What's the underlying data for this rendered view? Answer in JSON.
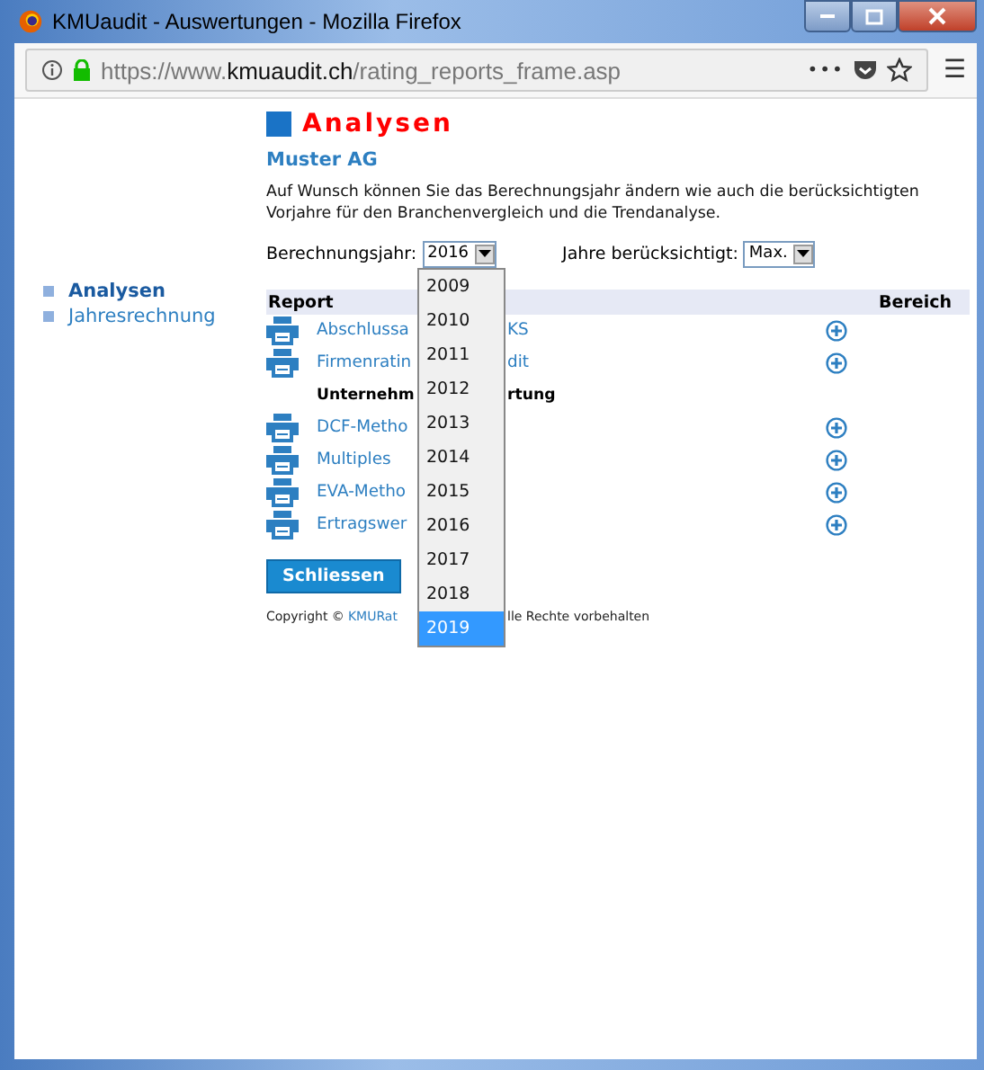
{
  "window": {
    "title": "KMUaudit - Auswertungen - Mozilla Firefox"
  },
  "address_bar": {
    "url_prefix": "https://www.",
    "url_domain": "kmuaudit.ch",
    "url_path": "/rating_reports_frame.asp",
    "menu_dots": "•••",
    "hamburger": "☰"
  },
  "sidebar": {
    "items": [
      {
        "label": "Analysen",
        "selected": true
      },
      {
        "label": "Jahresrechnung",
        "selected": false
      }
    ]
  },
  "page": {
    "heading": "Analysen",
    "company": "Muster AG",
    "description": "Auf Wunsch können Sie das Berechnungsjahr ändern wie auch die berücksichtigten Vorjahre für den Branchenvergleich und die Trendanalyse.",
    "year_select": {
      "label": "Berechnungsjahr:",
      "value": "2016"
    },
    "years_select": {
      "label": "Jahre berücksichtigt:",
      "value": "Max."
    },
    "year_options": [
      {
        "label": "2009",
        "selected": false
      },
      {
        "label": "2010",
        "selected": false
      },
      {
        "label": "2011",
        "selected": false
      },
      {
        "label": "2012",
        "selected": false
      },
      {
        "label": "2013",
        "selected": false
      },
      {
        "label": "2014",
        "selected": false
      },
      {
        "label": "2015",
        "selected": false
      },
      {
        "label": "2016",
        "selected": false
      },
      {
        "label": "2017",
        "selected": false
      },
      {
        "label": "2018",
        "selected": false
      },
      {
        "label": "2019",
        "selected": true
      }
    ],
    "table": {
      "columns": [
        "Report",
        "Bereich"
      ],
      "rows": [
        {
          "kind": "report",
          "label_start": "Abschlussa",
          "label_end": "KS"
        },
        {
          "kind": "report",
          "label_start": "Firmenratin",
          "label_end": "dit"
        },
        {
          "kind": "group",
          "label_start": "Unternehm",
          "label_end": "rtung"
        },
        {
          "kind": "report",
          "label_start": "DCF-Metho"
        },
        {
          "kind": "report",
          "label_start": "Multiples"
        },
        {
          "kind": "report",
          "label_start": "EVA-Metho"
        },
        {
          "kind": "report",
          "label_start": "Ertragswer"
        }
      ]
    },
    "close_button": "Schliessen",
    "copyright": {
      "prefix": "Copyright ©",
      "link": "KMURat",
      "suffix": "lle Rechte vorbehalten"
    }
  }
}
